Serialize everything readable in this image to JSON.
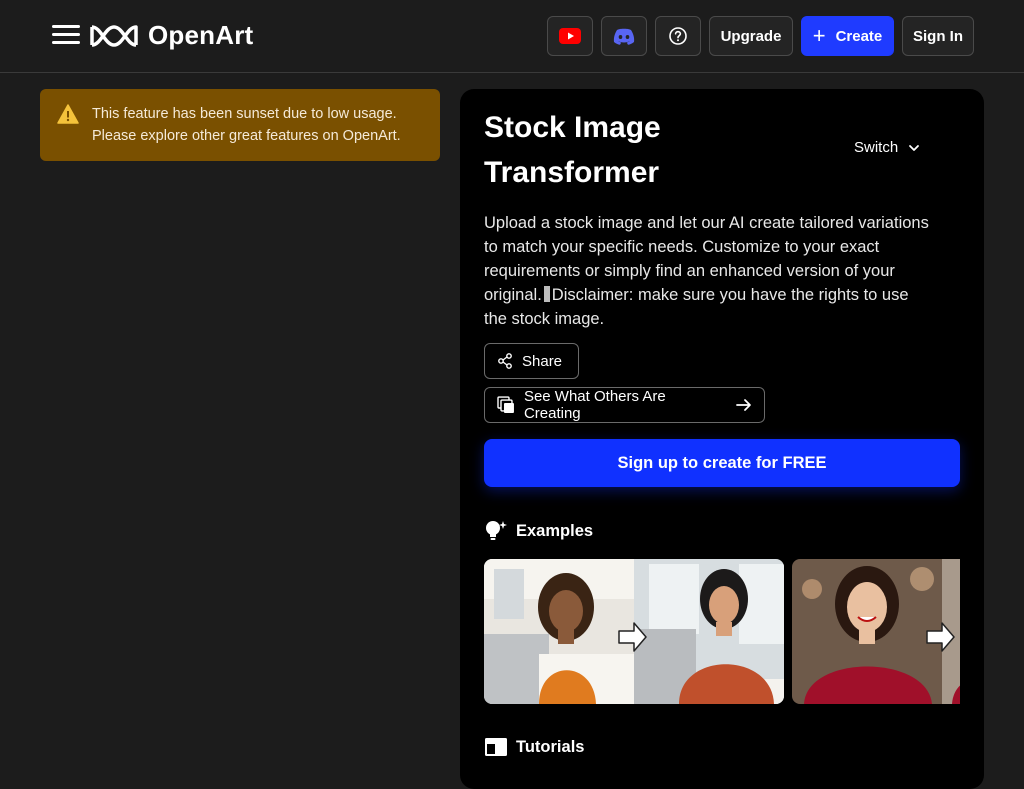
{
  "header": {
    "brand": "OpenArt",
    "upgrade_label": "Upgrade",
    "create_label": "Create",
    "signin_label": "Sign In",
    "icons": [
      "menu-icon",
      "openart-logo-icon",
      "youtube-icon",
      "discord-icon",
      "help-icon",
      "plus-icon"
    ]
  },
  "banner": {
    "line1": "This feature has been sunset due to low usage.",
    "line2": "Please explore other great features on OpenArt.",
    "icon": "warning-icon",
    "color": "#7a5000"
  },
  "tool": {
    "title_line1": "Stock Image",
    "title_line2": "Transformer",
    "switch_label": "Switch",
    "description_part1": "Upload a stock image and let our AI create tailored variations to match your specific needs. Customize to your exact requirements or simply find an enhanced version of your original.",
    "description_part2": "Disclaimer: make sure you have the rights to use the stock image.",
    "share_label": "Share",
    "others_label": "See What Others Are Creating",
    "cta_label": "Sign up to create for FREE",
    "examples_label": "Examples",
    "tutorials_label": "Tutorials"
  },
  "colors": {
    "accent": "#1f3bff",
    "background": "#1c1c1c",
    "card": "#000000",
    "youtube": "#ff0000",
    "discord": "#5865f2"
  }
}
